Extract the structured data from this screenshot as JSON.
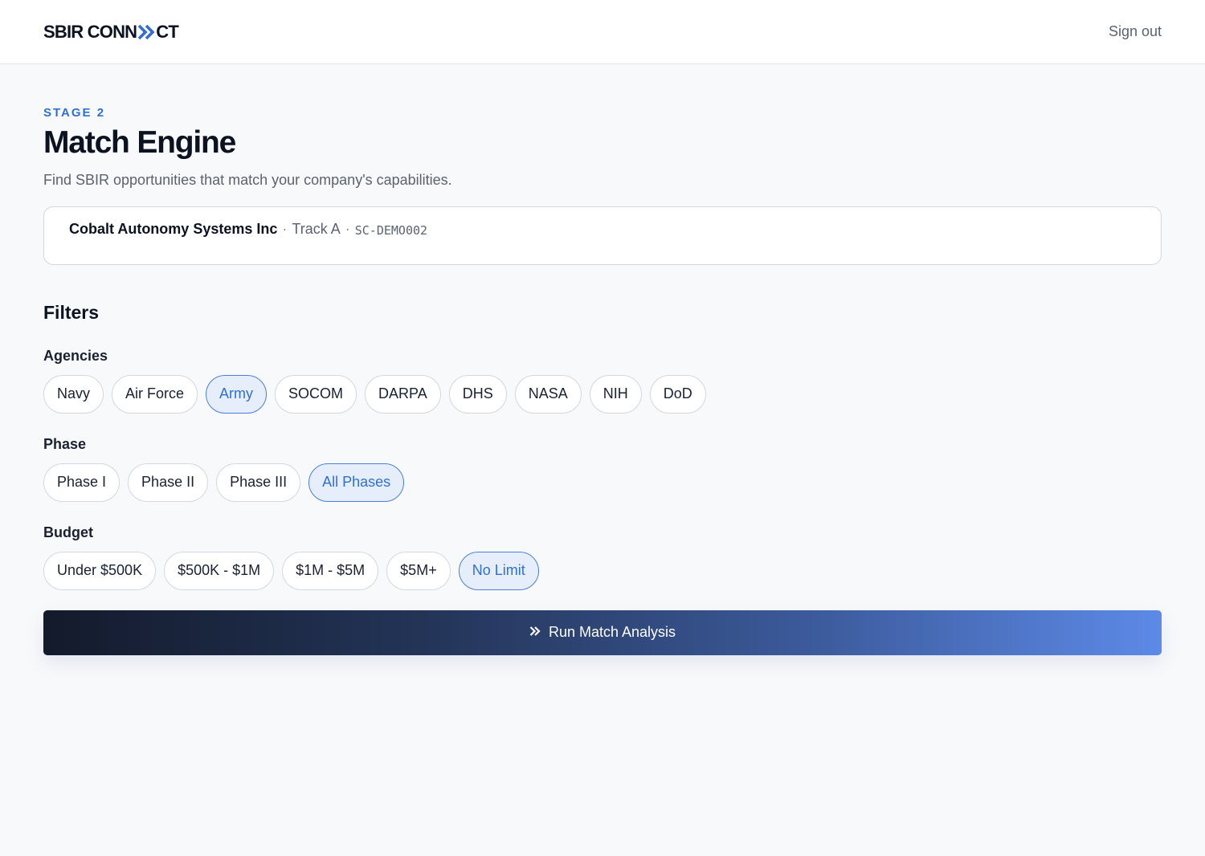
{
  "header": {
    "logo_left": "SBIR CONN",
    "logo_right": "CT",
    "sign_out_label": "Sign out"
  },
  "page": {
    "stage_label": "STAGE 2",
    "title": "Match Engine",
    "subtitle": "Find SBIR opportunities that match your company's capabilities."
  },
  "company": {
    "name": "Cobalt Autonomy Systems Inc",
    "separator": "·",
    "track": "Track A",
    "code": "SC-DEMO002"
  },
  "filters": {
    "title": "Filters",
    "agencies": {
      "label": "Agencies",
      "options": [
        "Navy",
        "Air Force",
        "Army",
        "SOCOM",
        "DARPA",
        "DHS",
        "NASA",
        "NIH",
        "DoD"
      ],
      "selected": [
        "Army"
      ]
    },
    "phase": {
      "label": "Phase",
      "options": [
        "Phase I",
        "Phase II",
        "Phase III",
        "All Phases"
      ],
      "selected": [
        "All Phases"
      ]
    },
    "budget": {
      "label": "Budget",
      "options": [
        "Under $500K",
        "$500K - $1M",
        "$1M - $5M",
        "$5M+",
        "No Limit"
      ],
      "selected": [
        "No Limit"
      ]
    }
  },
  "actions": {
    "run_label": "Run Match Analysis",
    "run_icon": "double-chevron-right-icon"
  },
  "colors": {
    "accent": "#2f6fd6",
    "selected_bg": "#e6eefb",
    "selected_border": "#4a7fd9",
    "button_gradient_start": "#131a2b",
    "button_gradient_end": "#5d8ae8"
  }
}
